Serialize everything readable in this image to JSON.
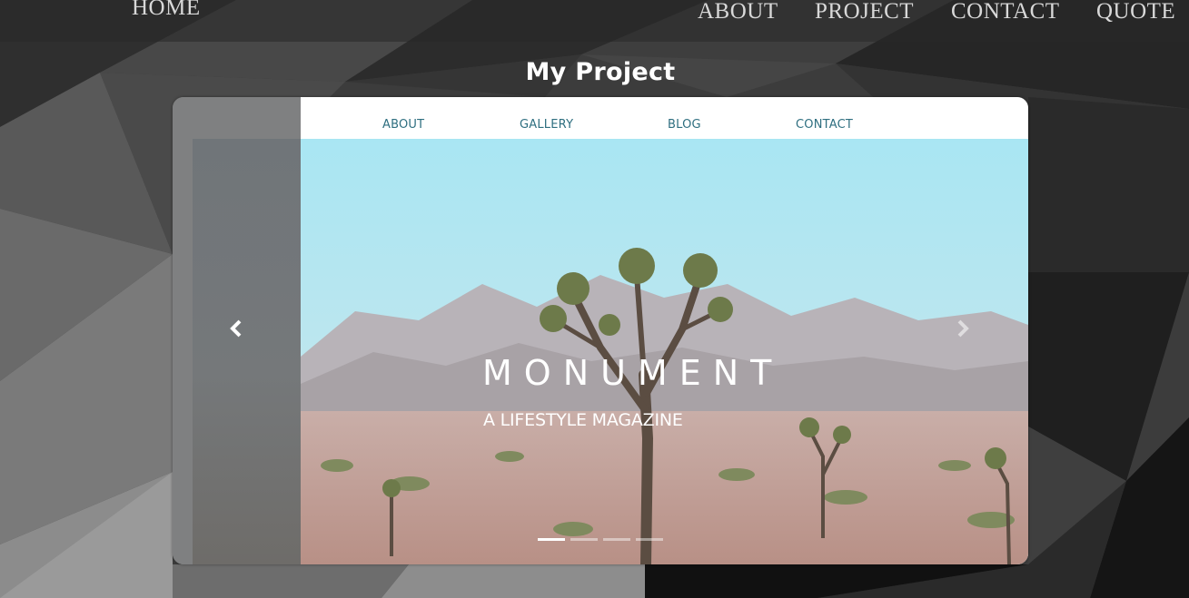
{
  "topnav": {
    "home": "HOME",
    "about": "ABOUT",
    "project": "PROJECT",
    "contact": "CONTACT",
    "quote": "QUOTE"
  },
  "page_title": "My Project",
  "carousel": {
    "site_nav": {
      "about": "ABOUT",
      "gallery": "GALLERY",
      "blog": "BLOG",
      "contact": "CONTACT"
    },
    "hero_title": "MONUMENT",
    "hero_subtitle": "A LIFESTYLE MAGAZINE",
    "prev_icon": "chevron-left-icon",
    "next_icon": "chevron-right-icon",
    "indicator_count": 4,
    "active_indicator": 1
  },
  "colors": {
    "site_nav_link": "#2f6f80",
    "sky": "#aee4ee",
    "hero_text": "#ffffff"
  }
}
